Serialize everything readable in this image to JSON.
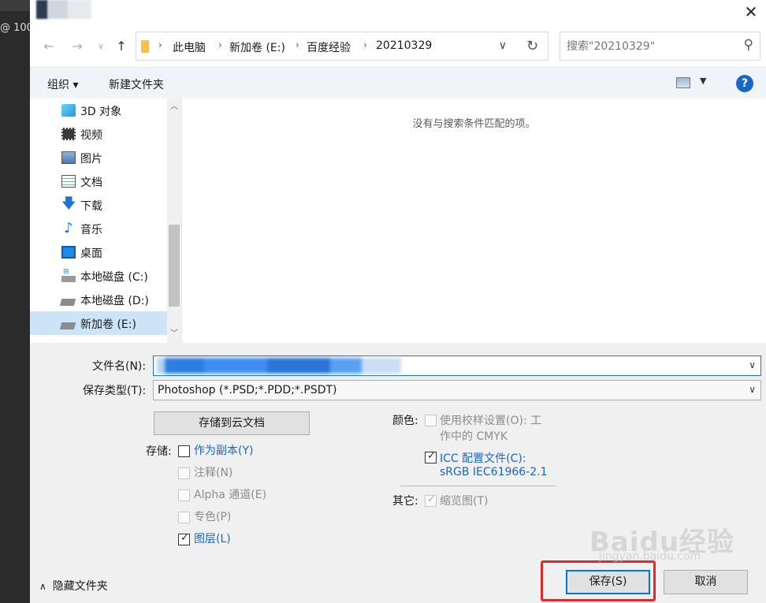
{
  "background_app": {
    "tab_text": "@ 100"
  },
  "titlebar": {
    "close_label": "✕"
  },
  "address": {
    "segments": [
      "此电脑",
      "新加卷 (E:)",
      "百度经验",
      "20210329"
    ]
  },
  "search": {
    "placeholder": "搜索\"20210329\""
  },
  "toolbar": {
    "organize": "组织 ▾",
    "new_folder": "新建文件夹",
    "help": "?"
  },
  "nav_pane": {
    "items": [
      {
        "label": "3D 对象",
        "icon": "cube-icon"
      },
      {
        "label": "视频",
        "icon": "video-icon"
      },
      {
        "label": "图片",
        "icon": "picture-icon"
      },
      {
        "label": "文档",
        "icon": "document-icon"
      },
      {
        "label": "下载",
        "icon": "download-arrow-icon"
      },
      {
        "label": "音乐",
        "icon": "music-note-icon"
      },
      {
        "label": "桌面",
        "icon": "desktop-icon"
      },
      {
        "label": "本地磁盘 (C:)",
        "icon": "system-drive-icon"
      },
      {
        "label": "本地磁盘 (D:)",
        "icon": "drive-icon"
      },
      {
        "label": "新加卷 (E:)",
        "icon": "drive-icon",
        "selected": true
      }
    ]
  },
  "content": {
    "empty_message": "没有与搜索条件匹配的项。"
  },
  "form": {
    "filename_label": "文件名(N):",
    "filetype_label": "保存类型(T):",
    "filetype_value": "Photoshop (*.PSD;*.PDD;*.PSDT)",
    "cloud_button": "存储到云文档",
    "save_group_label": "存储:",
    "options": {
      "as_copy": "作为副本(Y)",
      "notes": "注释(N)",
      "alpha": "Alpha 通道(E)",
      "spot": "专色(P)",
      "layers": "图层(L)"
    },
    "color_label": "颜色:",
    "proof_setup_line1": "使用校样设置(O): 工",
    "proof_setup_line2": "作中的 CMYK",
    "icc_line1": "ICC 配置文件(C):",
    "icc_line2": "sRGB IEC61966-2.1",
    "other_label": "其它:",
    "thumbnail": "缩览图(T)",
    "hide_folders": "隐藏文件夹",
    "save_button": "保存(S)",
    "cancel_button": "取消"
  },
  "watermark": {
    "text": "Baidu经验",
    "sub": "jingyan.baidu.com"
  },
  "colors": {
    "accent": "#0078d7",
    "highlight": "#e02a2a",
    "selection": "#cce4f7"
  }
}
